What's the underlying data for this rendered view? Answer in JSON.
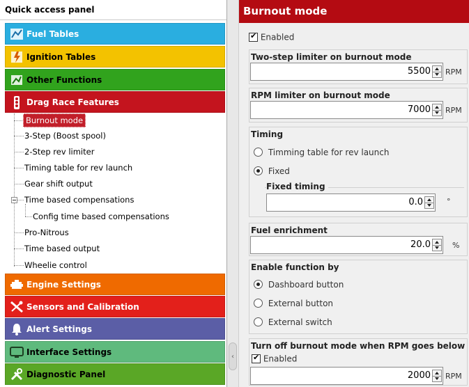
{
  "left_panel": {
    "title": "Quick access panel",
    "categories": [
      {
        "label": "Fuel Tables",
        "color": "#2aaee0",
        "text_color": "#ffffff",
        "icon": "fuel-tables-icon"
      },
      {
        "label": "Ignition Tables",
        "color": "#f3c200",
        "text_color": "#000000",
        "icon": "ignition-tables-icon"
      },
      {
        "label": "Other Functions",
        "color": "#31a31d",
        "text_color": "#000000",
        "icon": "other-functions-icon"
      },
      {
        "label": "Drag Race Features",
        "color": "#c4141e",
        "text_color": "#ffffff",
        "icon": "drag-race-icon"
      },
      {
        "label": "Engine Settings",
        "color": "#ef6a00",
        "text_color": "#ffffff",
        "icon": "engine-icon"
      },
      {
        "label": "Sensors and Calibration",
        "color": "#e3201b",
        "text_color": "#ffffff",
        "icon": "sensors-icon"
      },
      {
        "label": "Alert Settings",
        "color": "#5b5ea6",
        "text_color": "#ffffff",
        "icon": "alert-icon"
      },
      {
        "label": "Interface Settings",
        "color": "#5fba7d",
        "text_color": "#000000",
        "icon": "interface-icon"
      },
      {
        "label": "Diagnostic Panel",
        "color": "#5aa726",
        "text_color": "#000000",
        "icon": "diagnostic-icon"
      }
    ],
    "tree": [
      "Burnout mode",
      "3-Step (Boost spool)",
      "2-Step rev limiter",
      "Timing table for rev launch",
      "Gear shift output",
      "Time based compensations",
      "Config time based compensations",
      "Pro-Nitrous",
      "Time based output",
      "Wheelie control"
    ]
  },
  "right_panel": {
    "title": "Burnout mode",
    "enabled_label": "Enabled",
    "enabled": true,
    "two_step": {
      "title": "Two-step limiter on burnout mode",
      "value": "5500",
      "unit": "RPM"
    },
    "rpm_limiter": {
      "title": "RPM limiter on burnout mode",
      "value": "7000",
      "unit": "RPM"
    },
    "timing": {
      "title": "Timing",
      "options": [
        "Timming table for rev launch",
        "Fixed"
      ],
      "selected": 1,
      "fixed_title": "Fixed timing",
      "value": "0.0",
      "unit": "°"
    },
    "fuel": {
      "title": "Fuel enrichment",
      "value": "20.0",
      "unit": "%"
    },
    "enable_by": {
      "title": "Enable function by",
      "options": [
        "Dashboard button",
        "External button",
        "External switch"
      ],
      "selected": 0
    },
    "turn_off": {
      "title": "Turn off burnout mode when RPM goes below",
      "enabled_label": "Enabled",
      "enabled": true,
      "value": "2000",
      "unit": "RPM"
    }
  },
  "colors": {
    "header": "#b40b12",
    "selected": "#c21f2a"
  }
}
